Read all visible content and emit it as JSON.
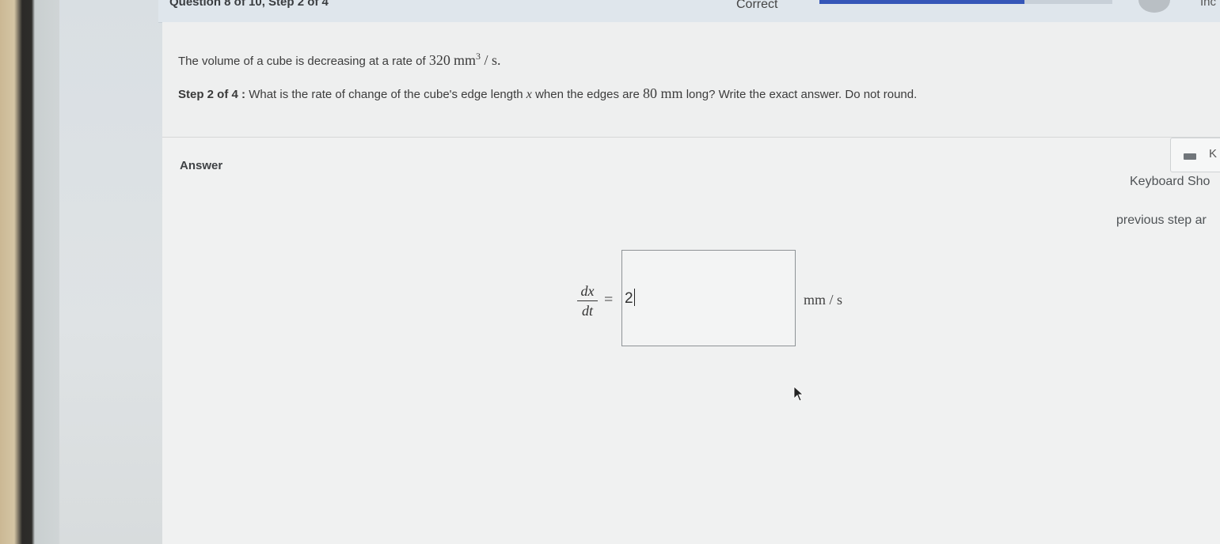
{
  "header": {
    "question_progress": "Question 8 of 10,  Step 2 of 4",
    "status": "Correct",
    "progress_fraction": 0.7,
    "corner_text": "Inc"
  },
  "question": {
    "intro": "The volume of a cube is decreasing at a rate of",
    "rate_value": "320",
    "rate_unit_base": "mm",
    "rate_unit_exp": "3",
    "rate_unit_tail": "/ s.",
    "step_label": "Step 2 of 4 :",
    "step_prefix": "What is the rate of change of the cube's edge length",
    "variable": "x",
    "step_mid": "when the edges are",
    "edge_value": "80 mm",
    "step_suffix": "long? Write the exact answer. Do not round."
  },
  "answer": {
    "label": "Answer",
    "keyboard_button_letter": "K",
    "keyboard_shortcuts": "Keyboard Sho",
    "previous_step": "previous step ar",
    "derivative_num": "dx",
    "derivative_den": "dt",
    "equals": "=",
    "input_value": "2",
    "unit": "mm / s"
  },
  "colors": {
    "progress": "#3556b8",
    "panel": "#f0f1f1"
  }
}
